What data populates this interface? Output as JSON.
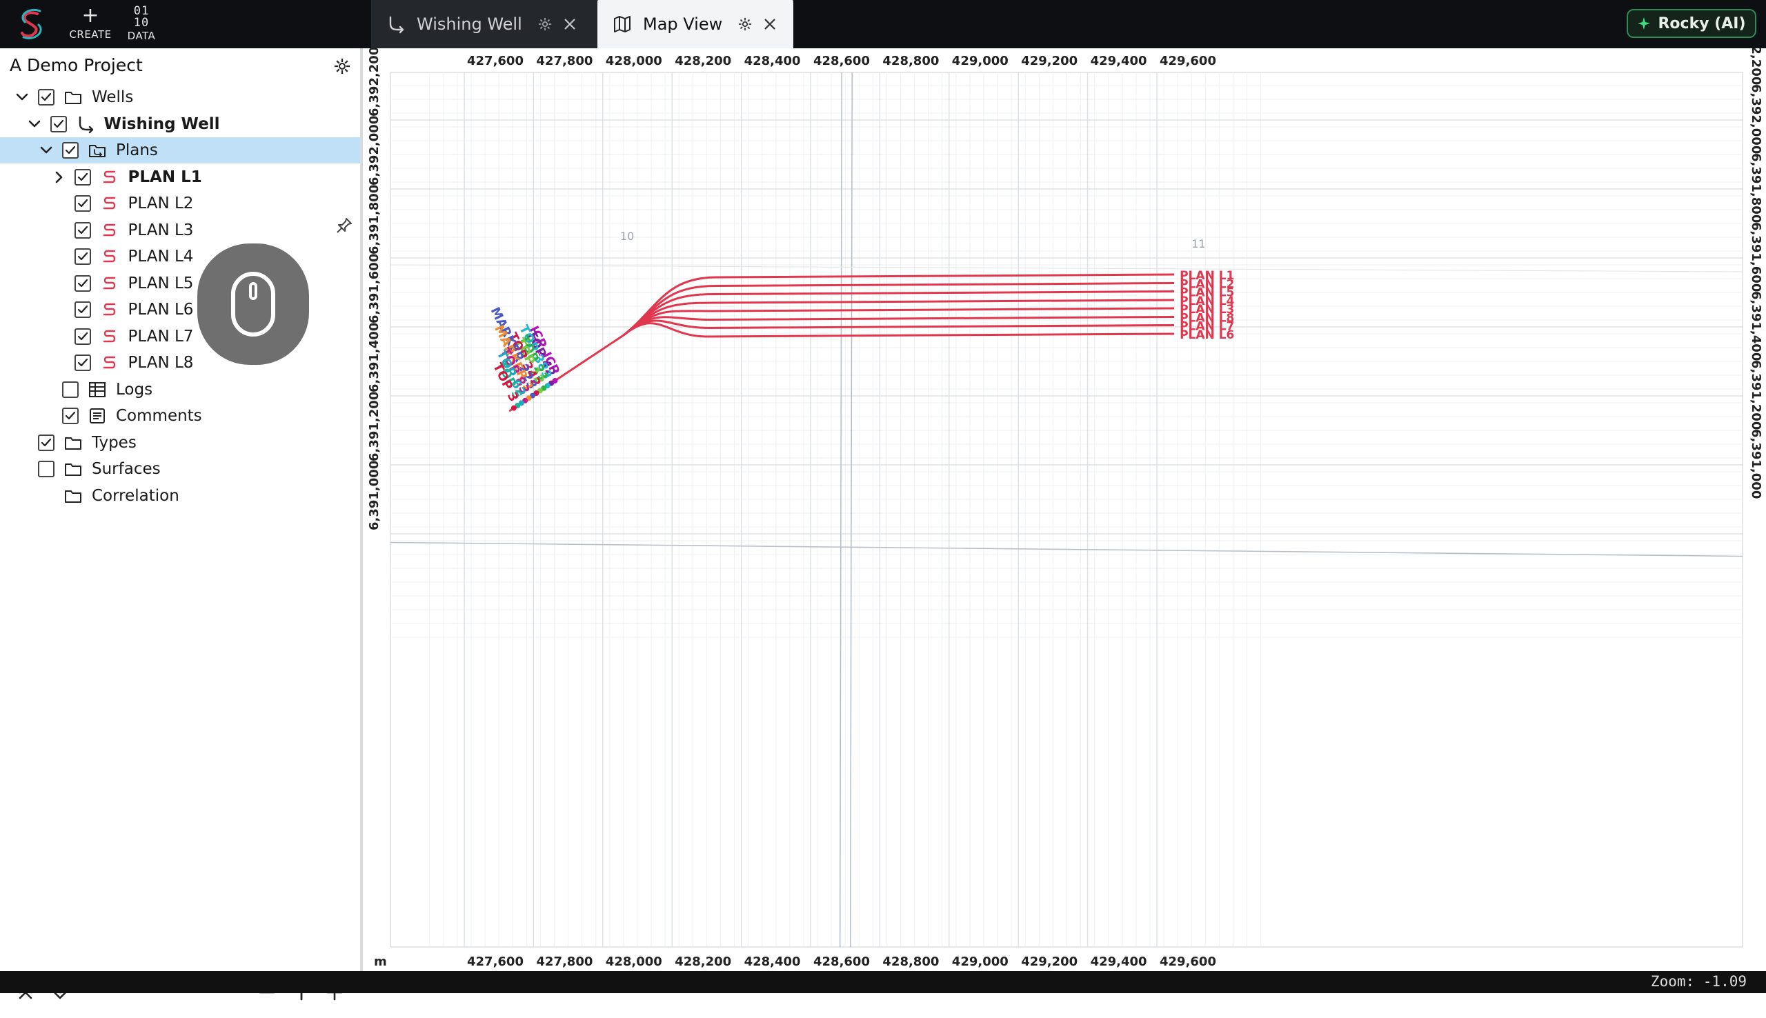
{
  "toolbar": {
    "create_label": "CREATE",
    "data_label": "DATA",
    "data_glyph_top": "01",
    "data_glyph_bottom": "10"
  },
  "tabs": [
    {
      "label": "Wishing Well",
      "icon": "well-icon",
      "active": false
    },
    {
      "label": "Map View",
      "icon": "map-icon",
      "active": true
    }
  ],
  "ai_button": {
    "label": "Rocky (AI)",
    "accent": "#2e8b57"
  },
  "sidebar": {
    "project_title": "A Demo Project",
    "tree": [
      {
        "label": "Wells",
        "checked": true,
        "icon": "folder-icon",
        "chevron": "down"
      },
      {
        "label": "Wishing Well",
        "checked": true,
        "icon": "well-icon",
        "chevron": "down",
        "bold": true
      },
      {
        "label": "Plans",
        "checked": true,
        "icon": "plans-folder-icon",
        "chevron": "down",
        "selected": true
      },
      {
        "label": "PLAN L1",
        "checked": true,
        "icon": "plan-icon",
        "chevron": "right",
        "bold": true
      },
      {
        "label": "PLAN L2",
        "checked": true,
        "icon": "plan-icon"
      },
      {
        "label": "PLAN L3",
        "checked": true,
        "icon": "plan-icon"
      },
      {
        "label": "PLAN L4",
        "checked": true,
        "icon": "plan-icon"
      },
      {
        "label": "PLAN L5",
        "checked": true,
        "icon": "plan-icon"
      },
      {
        "label": "PLAN L6",
        "checked": true,
        "icon": "plan-icon"
      },
      {
        "label": "PLAN L7",
        "checked": true,
        "icon": "plan-icon"
      },
      {
        "label": "PLAN L8",
        "checked": true,
        "icon": "plan-icon"
      },
      {
        "label": "Logs",
        "checked": false,
        "icon": "table-icon"
      },
      {
        "label": "Comments",
        "checked": true,
        "icon": "comment-icon"
      },
      {
        "label": "Types",
        "checked": true,
        "icon": "folder-icon"
      },
      {
        "label": "Surfaces",
        "checked": false,
        "icon": "folder-icon"
      },
      {
        "label": "Correlation",
        "icon": "folder-icon"
      }
    ]
  },
  "map": {
    "unit_label": "m",
    "x_ticks": [
      "427,600",
      "427,800",
      "428,000",
      "428,200",
      "428,400",
      "428,600",
      "428,800",
      "429,000",
      "429,200",
      "429,400",
      "429,600"
    ],
    "y_ticks": [
      "6,392,200",
      "6,392,000",
      "6,391,800",
      "6,391,600",
      "6,391,400",
      "6,391,200",
      "6,391,000"
    ],
    "section_numbers": [
      {
        "text": "10",
        "map_x": 428050,
        "map_y": 6391852
      },
      {
        "text": "11",
        "map_x": 429700,
        "map_y": 6391830
      }
    ],
    "plan_color": "#e0374f",
    "plans": [
      {
        "name": "PLAN L1",
        "end_y": 6391744
      },
      {
        "name": "PLAN L2",
        "end_y": 6391719
      },
      {
        "name": "PLAN L5",
        "end_y": 6391695
      },
      {
        "name": "PLAN L4",
        "end_y": 6391670
      },
      {
        "name": "PLAN L3",
        "end_y": 6391646
      },
      {
        "name": "PLAN L8",
        "end_y": 6391621
      },
      {
        "name": "PLAN L7",
        "end_y": 6391597
      },
      {
        "name": "PLAN L6",
        "end_y": 6391572
      }
    ],
    "markers": [
      {
        "label": "ICP_ICP",
        "color": "#b312b5"
      },
      {
        "label": "TOP 42",
        "color": "#7a1fa2"
      },
      {
        "label": "TOP 383",
        "color": "#1fb8cc"
      },
      {
        "label": "TOP 21",
        "color": "#2bb34a"
      },
      {
        "label": "TOP 12",
        "color": "#7ac943"
      },
      {
        "label": "TOP 342",
        "color": "#d1154d"
      },
      {
        "label": "MARKER 223",
        "color": "#4a59c7"
      },
      {
        "label": "MARKER 1",
        "color": "#ef8a2e"
      },
      {
        "label": "TOP 83",
        "color": "#c21d8b"
      },
      {
        "label": "TOP 62",
        "color": "#22a7c2"
      },
      {
        "label": "TOP 5",
        "color": "#1fb29a"
      },
      {
        "label": "TOP 3",
        "color": "#d9143d"
      }
    ]
  },
  "status": {
    "zoom_text": "Zoom: -1.09"
  }
}
